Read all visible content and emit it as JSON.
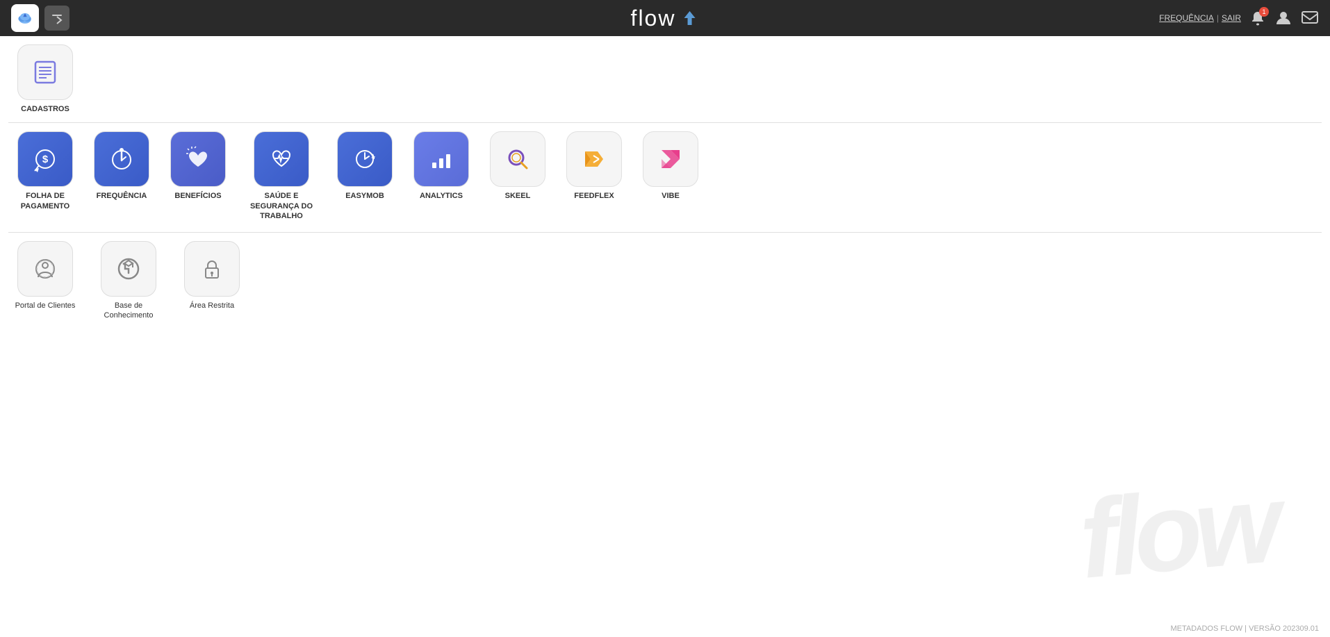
{
  "header": {
    "title": "flow",
    "nav_links": {
      "frequencia": "FREQUÊNCIA",
      "separator": "|",
      "sair": "SAIR"
    },
    "notification_count": "1"
  },
  "cadastros_section": {
    "items": [
      {
        "id": "cadastros",
        "label": "CADASTROS",
        "icon": "list",
        "bg": "light"
      }
    ]
  },
  "apps_section": {
    "items": [
      {
        "id": "folha-pagamento",
        "label": "FOLHA DE PAGAMENTO",
        "icon": "pay",
        "bg": "blue-pay"
      },
      {
        "id": "frequencia",
        "label": "FREQUÊNCIA",
        "icon": "freq",
        "bg": "blue-freq"
      },
      {
        "id": "beneficios",
        "label": "BENEFÍCIOS",
        "icon": "benef",
        "bg": "blue-benef"
      },
      {
        "id": "saude-seguranca",
        "label": "SAÚDE E SEGURANÇA DO TRABALHO",
        "icon": "saude",
        "bg": "blue-saude"
      },
      {
        "id": "easymob",
        "label": "EASYMOB",
        "icon": "easy",
        "bg": "blue-easy"
      },
      {
        "id": "analytics",
        "label": "ANALYTICS",
        "icon": "analytics",
        "bg": "blue-analytics"
      },
      {
        "id": "skeel",
        "label": "SKEEL",
        "icon": "skeel",
        "bg": "skeel"
      },
      {
        "id": "feedflex",
        "label": "FEEDFLEX",
        "icon": "feedflex",
        "bg": "feedflex"
      },
      {
        "id": "vibe",
        "label": "VIBE",
        "icon": "vibe",
        "bg": "vibe"
      }
    ]
  },
  "portal_section": {
    "items": [
      {
        "id": "portal-clientes",
        "label": "Portal de Clientes",
        "icon": "portal",
        "bg": "light"
      },
      {
        "id": "base-conhecimento",
        "label": "Base de Conhecimento",
        "icon": "knowledge",
        "bg": "light"
      },
      {
        "id": "area-restrita",
        "label": "Área Restrita",
        "icon": "lock",
        "bg": "light"
      }
    ]
  },
  "footer": {
    "text": "METADADOS FLOW | VERSÃO 202309.01"
  }
}
